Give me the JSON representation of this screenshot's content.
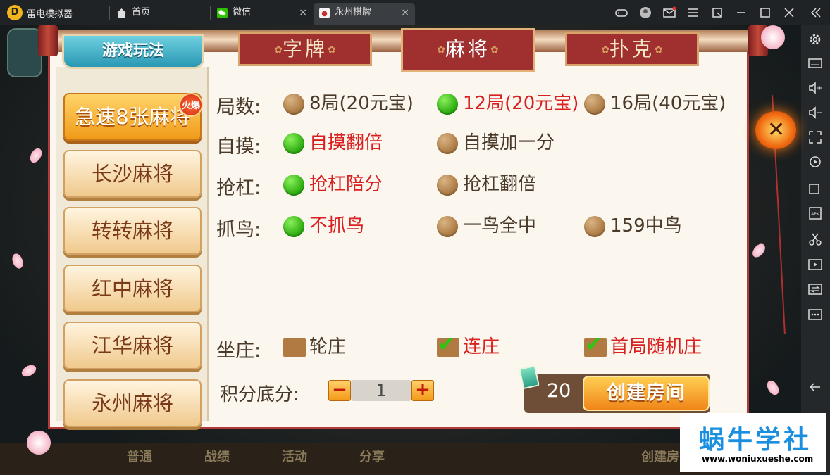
{
  "titlebar": {
    "app_title": "雷电模拟器",
    "tabs": [
      {
        "label": "首页",
        "icon": "home-icon"
      },
      {
        "label": "微信",
        "icon": "wechat-icon",
        "close": "×"
      },
      {
        "label": "永州棋牌",
        "icon": "app-icon",
        "close": "×"
      }
    ]
  },
  "game": {
    "play_tab": "游戏玩法",
    "category_tabs": [
      "字牌",
      "麻将",
      "扑克"
    ],
    "active_category": "麻将",
    "game_list": [
      "急速8张麻将",
      "长沙麻将",
      "转转麻将",
      "红中麻将",
      "江华麻将",
      "永州麻将"
    ],
    "hot_badge": "火爆",
    "rounds": {
      "label": "局数:",
      "options": [
        {
          "text": "8局(20元宝)",
          "selected": false
        },
        {
          "text": "12局(20元宝)",
          "selected": true
        },
        {
          "text": "16局(40元宝)",
          "selected": false
        }
      ]
    },
    "self_draw": {
      "label": "自摸:",
      "options": [
        {
          "text": "自摸翻倍",
          "selected": true
        },
        {
          "text": "自摸加一分",
          "selected": false
        }
      ]
    },
    "rob_kong": {
      "label": "抢杠:",
      "options": [
        {
          "text": "抢杠陪分",
          "selected": true
        },
        {
          "text": "抢杠翻倍",
          "selected": false
        }
      ]
    },
    "bird": {
      "label": "抓鸟:",
      "options": [
        {
          "text": "不抓鸟",
          "selected": true
        },
        {
          "text": "一鸟全中",
          "selected": false
        },
        {
          "text": "159中鸟",
          "selected": false
        }
      ]
    },
    "dealer": {
      "label": "坐庄:",
      "options": [
        {
          "text": "轮庄",
          "checked": false
        },
        {
          "text": "连庄",
          "checked": true
        },
        {
          "text": "首局随机庄",
          "checked": true
        }
      ]
    },
    "score": {
      "label": "积分底分:",
      "minus": "−",
      "value": "1",
      "plus": "+"
    },
    "cost": "20",
    "create_button": "创建房间",
    "close_symbol": "✕"
  },
  "background_buttons": [
    "普通",
    "战绩",
    "活动",
    "分享",
    "创建房"
  ],
  "watermark": {
    "title": "蜗牛学社",
    "url": "www.woniuxueshe.com"
  },
  "colors": {
    "selected_text": "#d92020",
    "accent_tab": "#a03030",
    "radio_on": "#27a80c"
  }
}
